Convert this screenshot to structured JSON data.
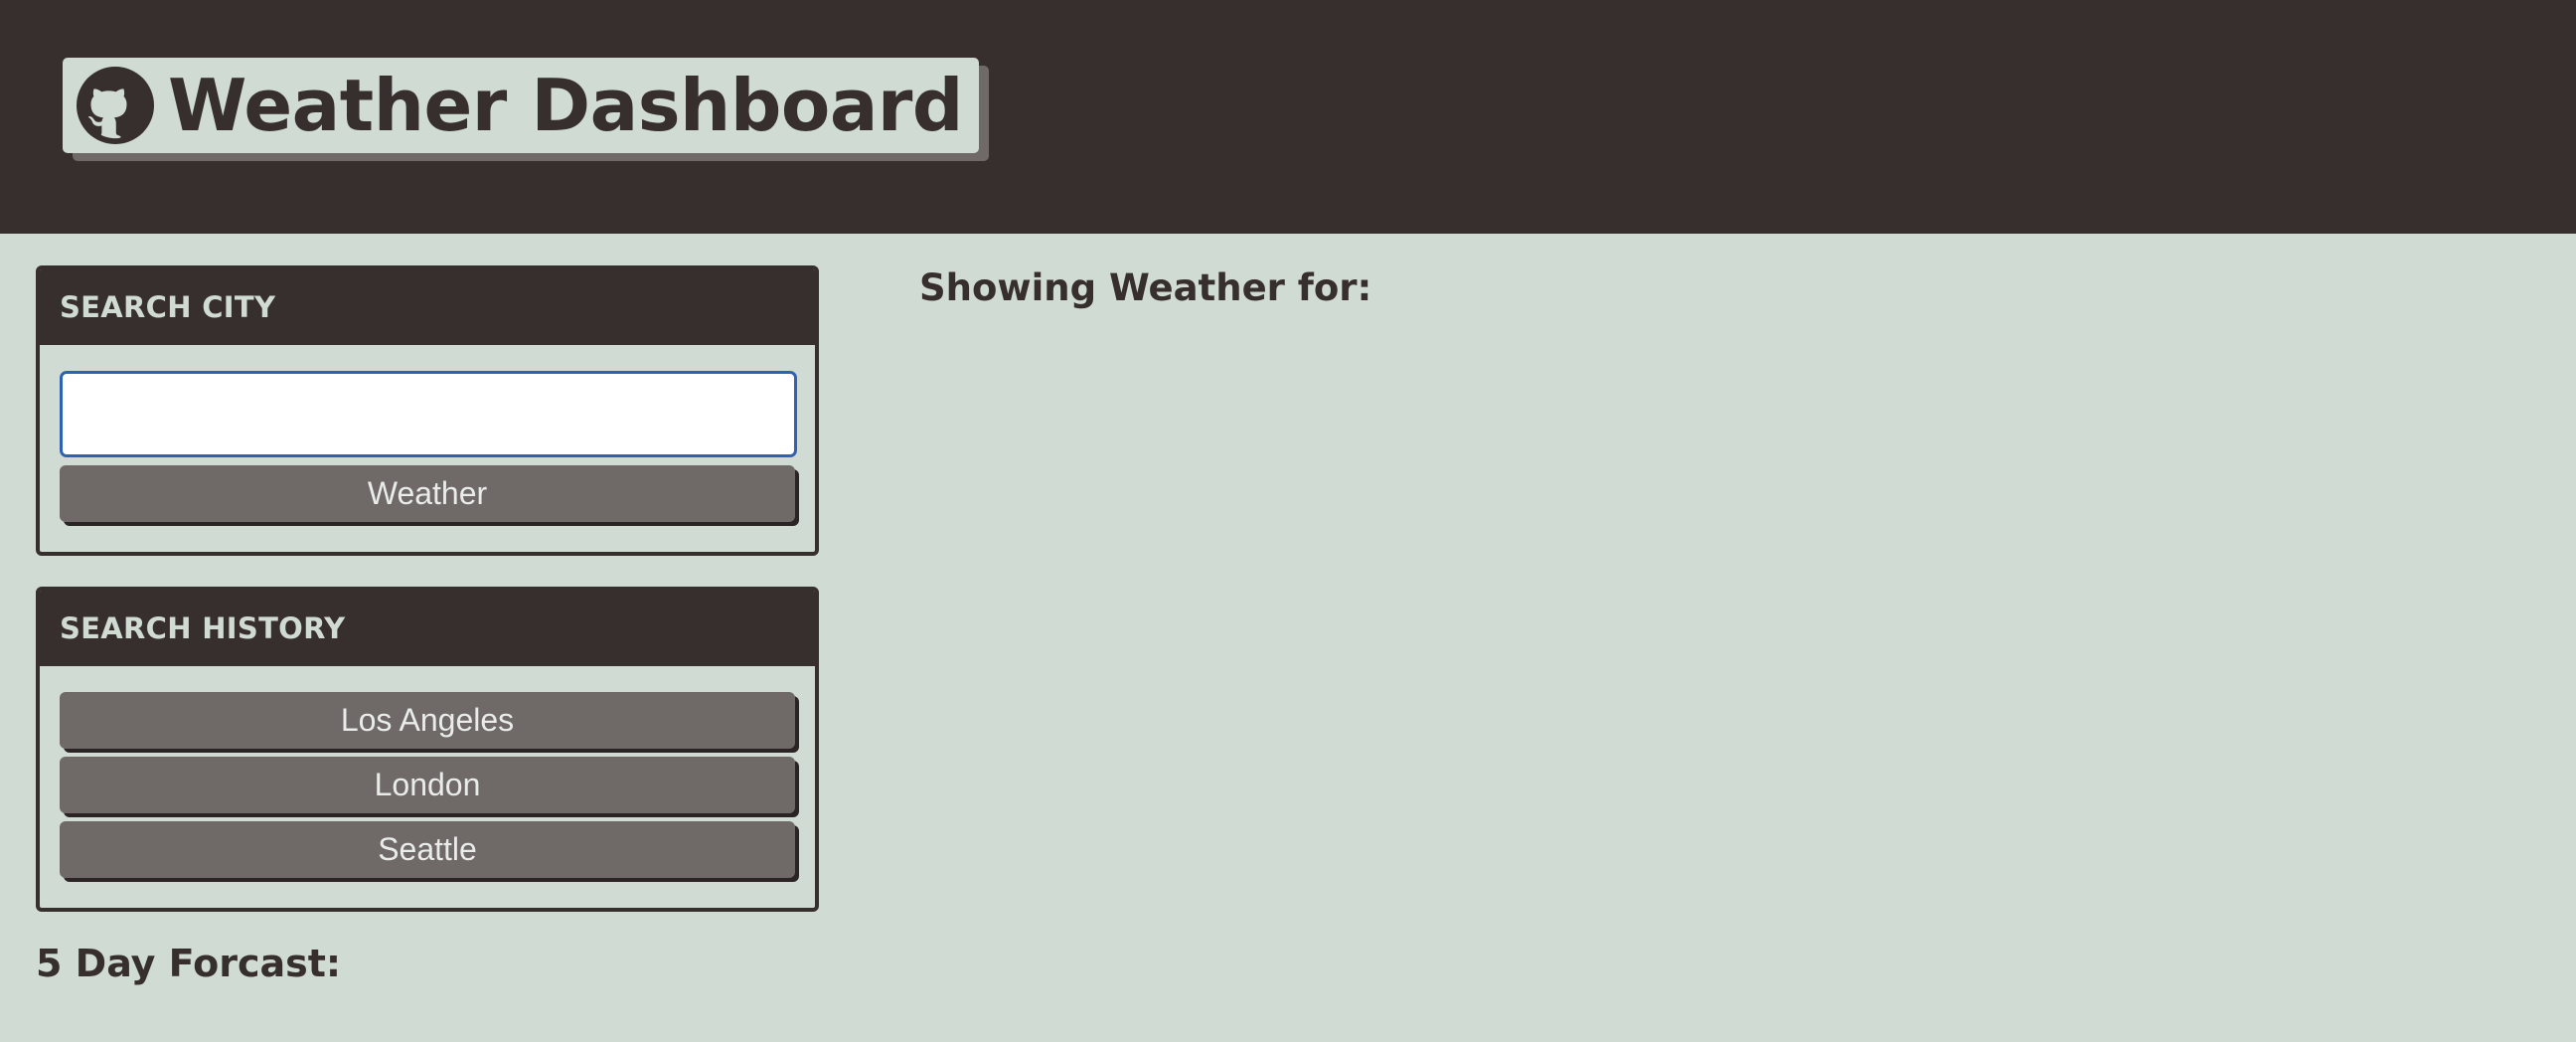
{
  "header": {
    "title": "Weather Dashboard",
    "icon": "github-icon"
  },
  "search_city": {
    "title": "SEARCH CITY",
    "input_value": "",
    "input_placeholder": "",
    "button_label": "Weather"
  },
  "search_history": {
    "title": "SEARCH HISTORY",
    "items": [
      {
        "label": "Los Angeles"
      },
      {
        "label": "London"
      },
      {
        "label": "Seattle"
      }
    ]
  },
  "forecast": {
    "title": "5 Day Forcast:"
  },
  "current_weather": {
    "title": "Showing Weather for:"
  },
  "colors": {
    "dark": "#372e2e",
    "background": "#cfdbd3",
    "button": "#6f6967",
    "input_border": "#2f62b5"
  }
}
